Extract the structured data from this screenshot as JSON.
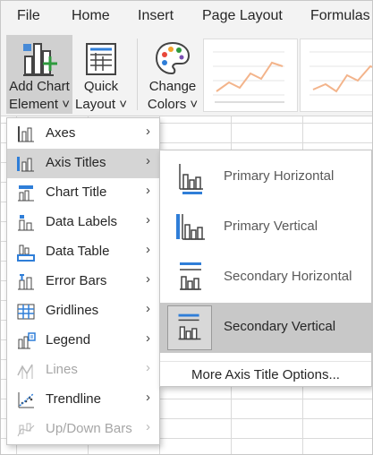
{
  "ribbon_tabs": [
    "File",
    "Home",
    "Insert",
    "Page Layout",
    "Formulas"
  ],
  "ribbon": {
    "add_chart_element": {
      "line1": "Add Chart",
      "line2": "Element ˅",
      "icon": "add-chart-element-icon"
    },
    "quick_layout": {
      "line1": "Quick",
      "line2": "Layout ˅",
      "icon": "quick-layout-icon"
    },
    "change_colors": {
      "line1": "Change",
      "line2": "Colors ˅",
      "icon": "palette-icon"
    },
    "chart_styles": [
      "chart-style-1",
      "chart-style-2"
    ]
  },
  "menu": {
    "items": [
      {
        "label": "Axes",
        "icon": "axes-icon",
        "enabled": true,
        "highlighted": false
      },
      {
        "label": "Axis Titles",
        "icon": "axis-titles-icon",
        "enabled": true,
        "highlighted": true
      },
      {
        "label": "Chart Title",
        "icon": "chart-title-icon",
        "enabled": true,
        "highlighted": false
      },
      {
        "label": "Data Labels",
        "icon": "data-labels-icon",
        "enabled": true,
        "highlighted": false
      },
      {
        "label": "Data Table",
        "icon": "data-table-icon",
        "enabled": true,
        "highlighted": false
      },
      {
        "label": "Error Bars",
        "icon": "error-bars-icon",
        "enabled": true,
        "highlighted": false
      },
      {
        "label": "Gridlines",
        "icon": "gridlines-icon",
        "enabled": true,
        "highlighted": false
      },
      {
        "label": "Legend",
        "icon": "legend-icon",
        "enabled": true,
        "highlighted": false
      },
      {
        "label": "Lines",
        "icon": "lines-icon",
        "enabled": false,
        "highlighted": false
      },
      {
        "label": "Trendline",
        "icon": "trendline-icon",
        "enabled": true,
        "highlighted": false
      },
      {
        "label": "Up/Down Bars",
        "icon": "up-down-bars-icon",
        "enabled": false,
        "highlighted": false
      }
    ],
    "arrow": "›"
  },
  "submenu": {
    "items": [
      {
        "label": "Primary Horizontal",
        "icon": "primary-horizontal-icon",
        "highlighted": false
      },
      {
        "label": "Primary Vertical",
        "icon": "primary-vertical-icon",
        "highlighted": false
      },
      {
        "label": "Secondary Horizontal",
        "icon": "secondary-horizontal-icon",
        "highlighted": false
      },
      {
        "label": "Secondary Vertical",
        "icon": "secondary-vertical-icon",
        "highlighted": true
      }
    ],
    "more_options": "More Axis Title Options..."
  },
  "colors": {
    "accent_blue": "#2f7ed8",
    "icon_gray": "#444444",
    "green_plus": "#2e9a3d"
  }
}
